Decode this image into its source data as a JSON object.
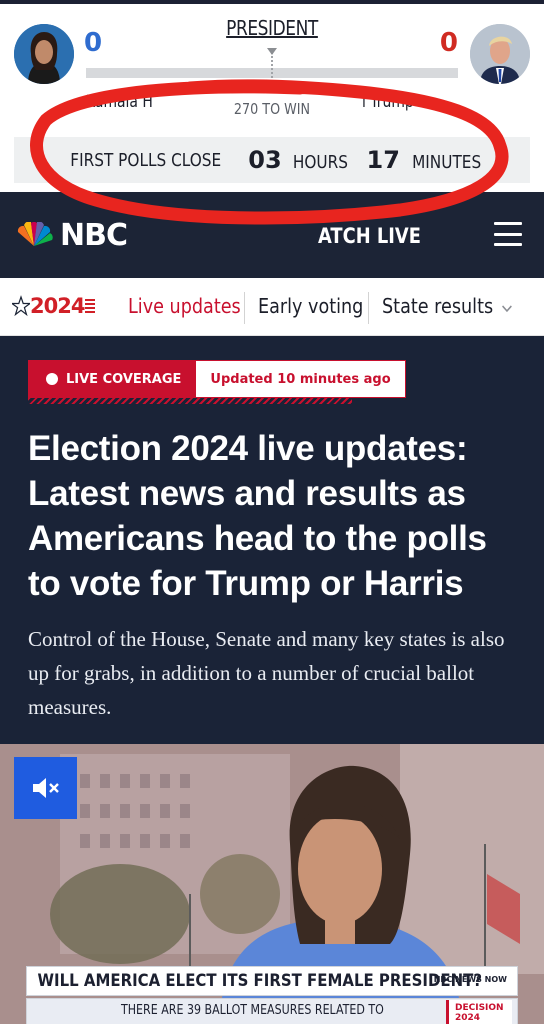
{
  "race_tracker": {
    "office": "PRESIDENT",
    "left_candidate": {
      "name": "Kamala Harris",
      "visible_name": "Kamala H",
      "electoral_votes": "0",
      "color": "#2f6ccf"
    },
    "right_candidate": {
      "name": "Donald Trump",
      "visible_name": "l Trump",
      "electoral_votes": "0",
      "color": "#d02b22"
    },
    "to_win": "270 TO WIN",
    "polls": {
      "label": "FIRST POLLS CLOSE",
      "hours": "03",
      "hours_unit": "HOURS",
      "minutes": "17",
      "minutes_unit": "MINUTES"
    }
  },
  "header": {
    "brand": "NBC NEWS",
    "brand_visible": "NBC",
    "watch_live": "WATCH LIVE",
    "watch_live_visible": "ATCH LIVE",
    "menu_icon": "hamburger-icon"
  },
  "subnav": {
    "logo": "2024",
    "items": [
      {
        "label": "Live updates",
        "active": true
      },
      {
        "label": "Early voting",
        "active": false
      },
      {
        "label": "State results",
        "active": false
      }
    ]
  },
  "article": {
    "live_label": "LIVE COVERAGE",
    "updated": "Updated 10 minutes ago",
    "headline": "Election 2024 live updates: Latest news and results as Americans head to the polls to vote for Trump or Harris",
    "dek": "Control of the House, Senate and many key states is also up for grabs, in addition to a number of crucial ballot measures."
  },
  "video": {
    "mute_icon": "speaker-muted-icon",
    "chyron": "WILL AMERICA ELECT ITS FIRST FEMALE PRESIDENT?",
    "chyron_tag": "NBC NEWS NOW",
    "lower_third": "THERE ARE 39 BALLOT MEASURES RELATED TO",
    "decision_badge": "DECISION 2024"
  },
  "colors": {
    "accent_red": "#c8102e",
    "header_navy": "#1c2436",
    "hero_navy": "#1a2337",
    "mute_blue": "#1f5ce0"
  }
}
